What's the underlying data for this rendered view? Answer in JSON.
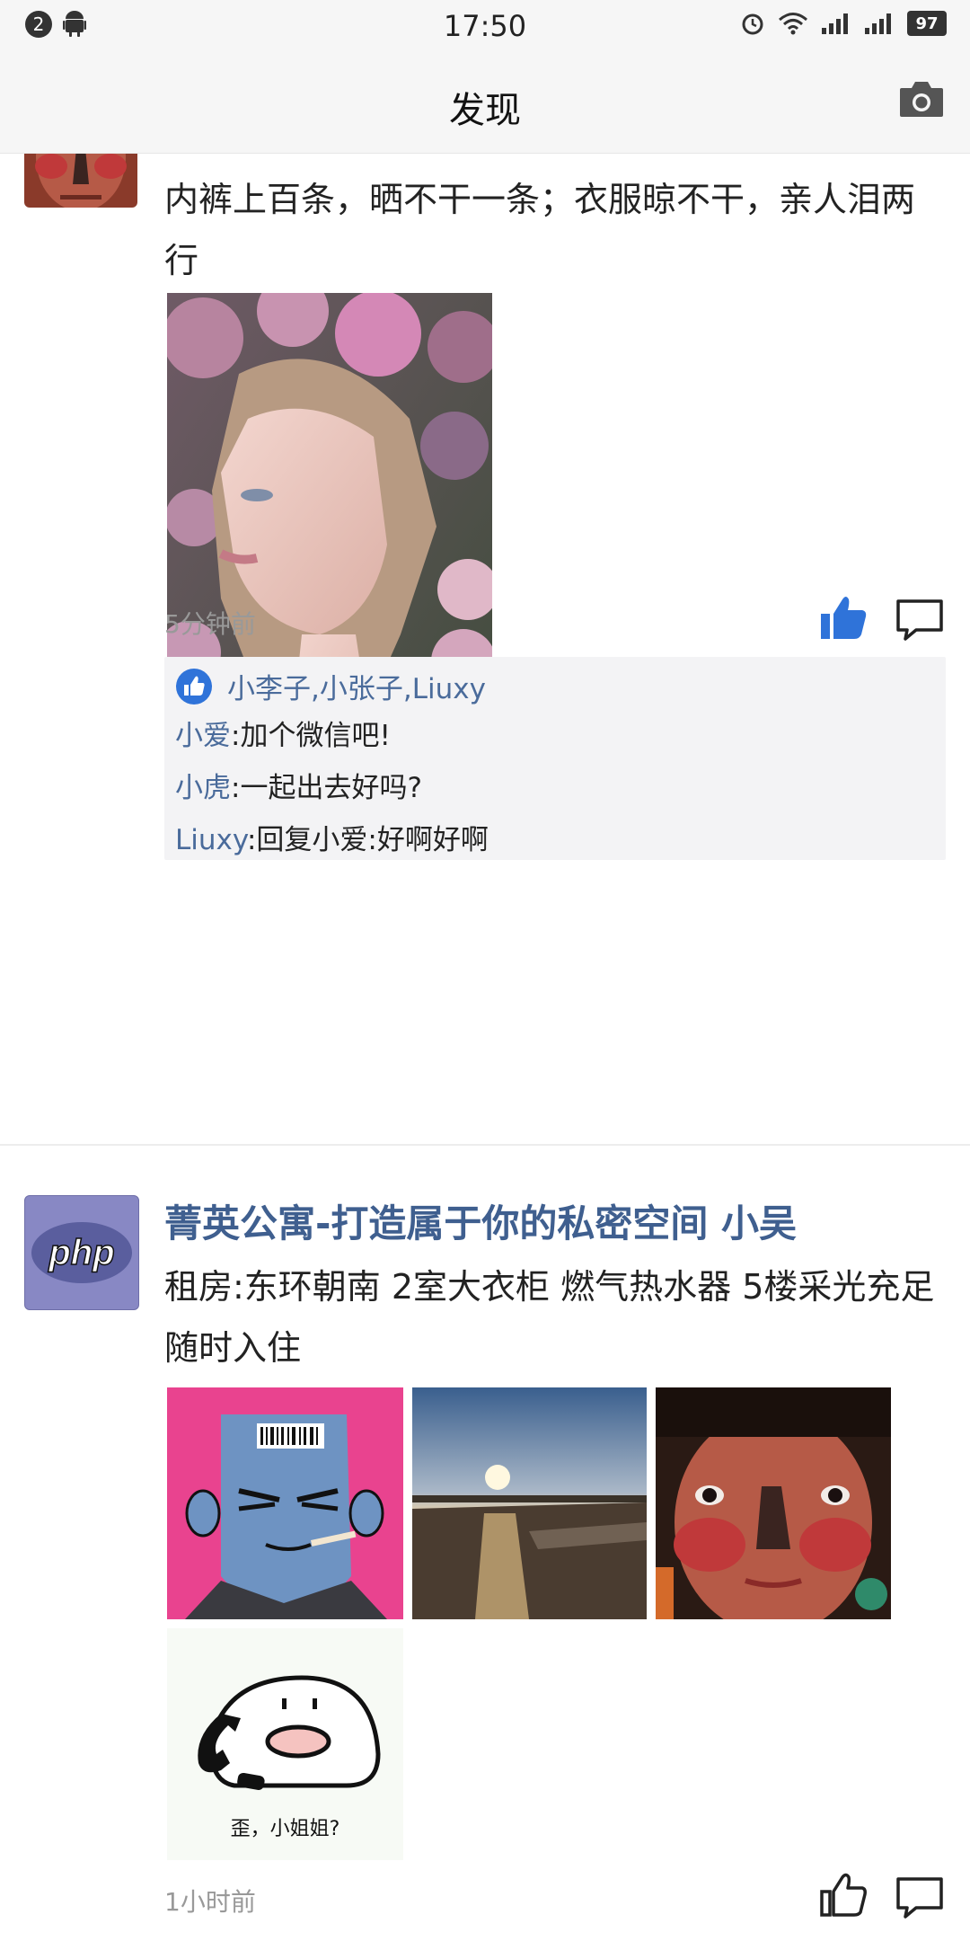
{
  "status_bar": {
    "notification_count": "2",
    "time": "17:50",
    "battery": "97"
  },
  "nav": {
    "title": "发现"
  },
  "posts": [
    {
      "text": "内裤上百条，晒不干一条；衣服晾不干，亲人泪两行",
      "time": "5分钟前",
      "liked_by": "小李子,小张子,Liuxy",
      "comments": [
        {
          "name": "小爱",
          "text": ":加个微信吧!"
        },
        {
          "name": "小虎",
          "text": ":一起出去好吗?"
        },
        {
          "name": "Liuxy",
          "text": ":回复小爱:好啊好啊"
        }
      ]
    },
    {
      "username": "菁英公寓-打造属于你的私密空间 小吴",
      "avatar_text": "php",
      "text": "租房:东环朝南 2室大衣柜 燃气热水器 5楼采光充足 随时入住",
      "time": "1小时前",
      "sticker_caption": "歪，小姐姐?"
    }
  ],
  "colors": {
    "link": "#3f5f8f",
    "like_blue": "#2f73d9",
    "background": "#ffffff"
  }
}
